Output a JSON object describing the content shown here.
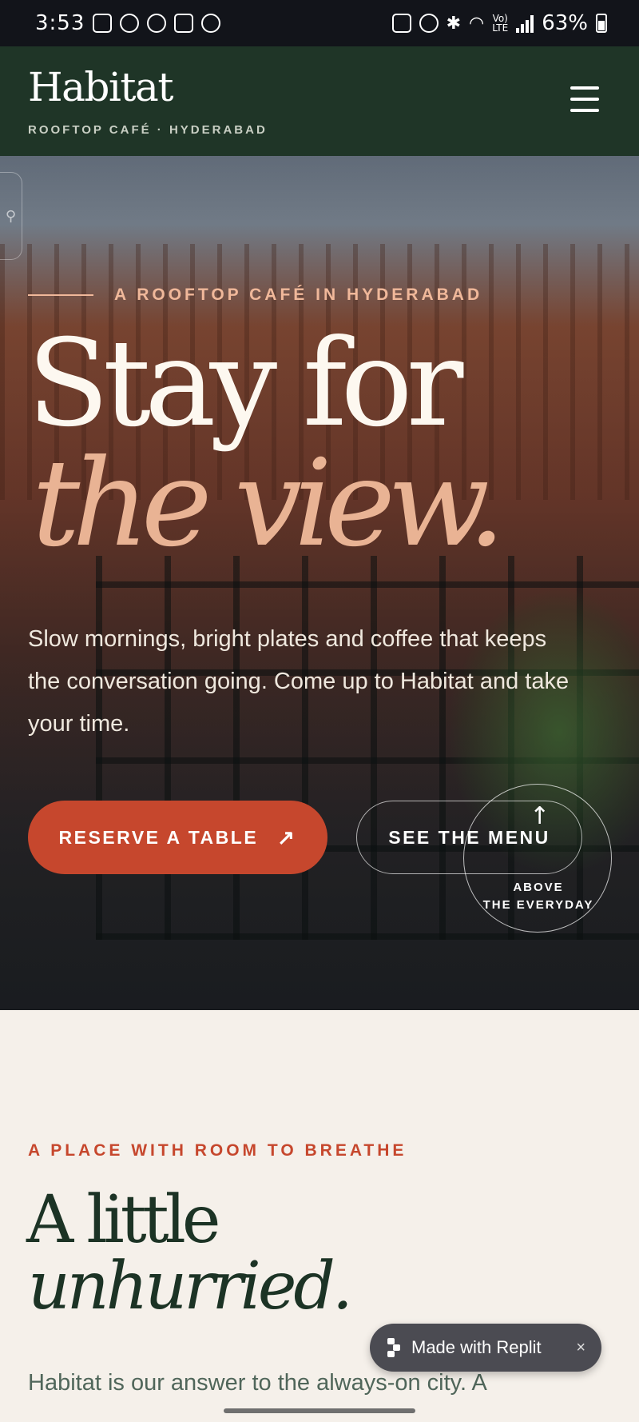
{
  "status_bar": {
    "time": "3:53",
    "battery": "63%"
  },
  "header": {
    "logo": "Habitat",
    "tagline": "ROOFTOP CAFÉ · HYDERABAD",
    "menu_icon": "hamburger-menu-icon"
  },
  "hero": {
    "eyebrow": "A ROOFTOP CAFÉ IN HYDERABAD",
    "headline_line1": "Stay for",
    "headline_line2": "the view.",
    "body": "Slow mornings, bright plates and coffee that keeps the conversation going. Come up to Habitat and take your time.",
    "reserve_label": "RESERVE A TABLE",
    "reserve_icon": "arrow-up-right-icon",
    "menu_label": "SEE THE MENU",
    "badge_line1": "ABOVE",
    "badge_line2": "THE EVERYDAY"
  },
  "section": {
    "eyebrow": "A PLACE WITH ROOM TO BREATHE",
    "heading_line1": "A little",
    "heading_line2": "unhurried.",
    "body": "Habitat is our answer to the always-on city. A"
  },
  "replit_badge": {
    "label": "Made with Replit",
    "close": "×"
  },
  "colors": {
    "header_bg": "#1f3527",
    "accent": "#c6472d",
    "peach": "#e9b394",
    "cream": "#f5f0ea",
    "dark_green": "#1c3325"
  }
}
